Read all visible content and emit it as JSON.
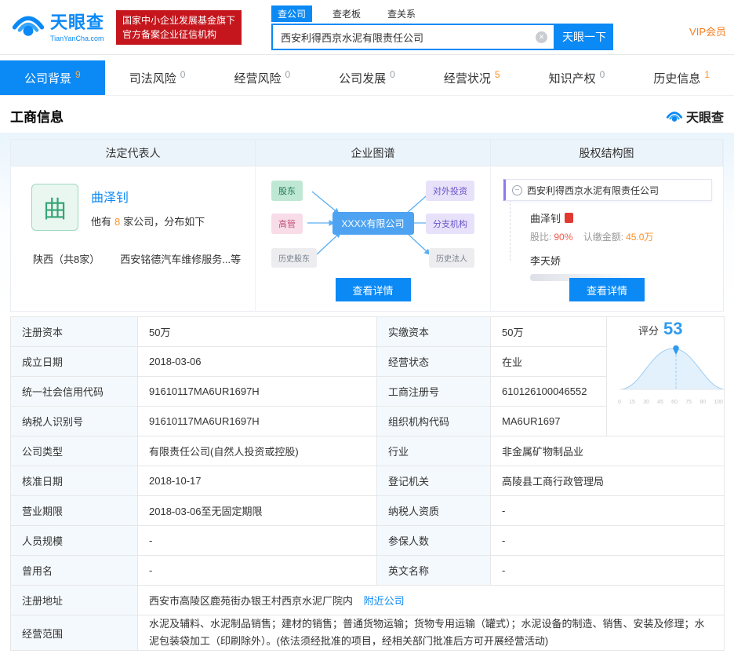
{
  "header": {
    "brand": {
      "name": "天眼查",
      "domain": "TianYanCha.com"
    },
    "cert": {
      "line1": "国家中小企业发展基金旗下",
      "line2": "官方备案企业征信机构"
    },
    "search": {
      "tabs": [
        {
          "label": "查公司"
        },
        {
          "label": "查老板"
        },
        {
          "label": "查关系"
        }
      ],
      "value": "西安利得西京水泥有限责任公司",
      "button": "天眼一下"
    },
    "vip": "VIP会员"
  },
  "nav": {
    "tabs": [
      {
        "label": "公司背景",
        "count": "9"
      },
      {
        "label": "司法风险",
        "count": "0"
      },
      {
        "label": "经营风险",
        "count": "0"
      },
      {
        "label": "公司发展",
        "count": "0"
      },
      {
        "label": "经营状况",
        "count": "5"
      },
      {
        "label": "知识产权",
        "count": "0"
      },
      {
        "label": "历史信息",
        "count": "1"
      }
    ]
  },
  "section": {
    "title": "工商信息",
    "brand": "天眼查"
  },
  "cards": {
    "headers": {
      "legal": "法定代表人",
      "graph": "企业图谱",
      "equity": "股权结构图"
    },
    "legal": {
      "avatar": "曲",
      "name": "曲泽钊",
      "desc_pre": "他有",
      "count": "8",
      "desc_post": "家公司，分布如下",
      "region": "陕西（共8家）",
      "sample": "西安铭德汽车维修服务...等"
    },
    "graph": {
      "nodes": {
        "shareholder": "股东",
        "executive": "高管",
        "history_shareholder": "历史股东",
        "center": "XXXX有限公司",
        "investment": "对外投资",
        "branch": "分支机构",
        "history_legal": "历史法人"
      },
      "button": "查看详情"
    },
    "equity": {
      "company": "西安利得西京水泥有限责任公司",
      "holder1": {
        "name": "曲泽钊",
        "ratio_label": "股比:",
        "ratio": "90%",
        "amount_label": "认缴金额:",
        "amount": "45.0万"
      },
      "holder2": {
        "name": "李天娇"
      },
      "button": "查看详情"
    }
  },
  "score": {
    "label": "评分",
    "value": "53",
    "axis": [
      "0",
      "15",
      "30",
      "45",
      "60",
      "75",
      "90",
      "100"
    ]
  },
  "table": {
    "rows": [
      {
        "label1": "注册资本",
        "value1": "50万",
        "label2": "实缴资本",
        "value2": "50万"
      },
      {
        "label1": "成立日期",
        "value1": "2018-03-06",
        "label2": "经营状态",
        "value2": "在业"
      },
      {
        "label1": "统一社会信用代码",
        "value1": "91610117MA6UR1697H",
        "label2": "工商注册号",
        "value2": "610126100046552"
      },
      {
        "label1": "纳税人识别号",
        "value1": "91610117MA6UR1697H",
        "label2": "组织机构代码",
        "value2": "MA6UR1697"
      },
      {
        "label1": "公司类型",
        "value1": "有限责任公司(自然人投资或控股)",
        "label2": "行业",
        "value2": "非金属矿物制品业"
      },
      {
        "label1": "核准日期",
        "value1": "2018-10-17",
        "label2": "登记机关",
        "value2": "高陵县工商行政管理局"
      },
      {
        "label1": "营业期限",
        "value1": "2018-03-06至无固定期限",
        "label2": "纳税人资质",
        "value2": "-"
      },
      {
        "label1": "人员规模",
        "value1": "-",
        "label2": "参保人数",
        "value2": "-"
      },
      {
        "label1": "曾用名",
        "value1": "-",
        "label2": "英文名称",
        "value2": "-"
      }
    ],
    "address": {
      "label": "注册地址",
      "value": "西安市高陵区鹿苑街办银王村西京水泥厂院内",
      "link": "附近公司"
    },
    "scope": {
      "label": "经营范围",
      "value": "水泥及辅料、水泥制品销售；建材的销售；普通货物运输；货物专用运输（罐式）；水泥设备的制造、销售、安装及修理；水泥包装袋加工（印刷除外）。(依法须经批准的项目，经相关部门批准后方可开展经营活动)"
    }
  }
}
